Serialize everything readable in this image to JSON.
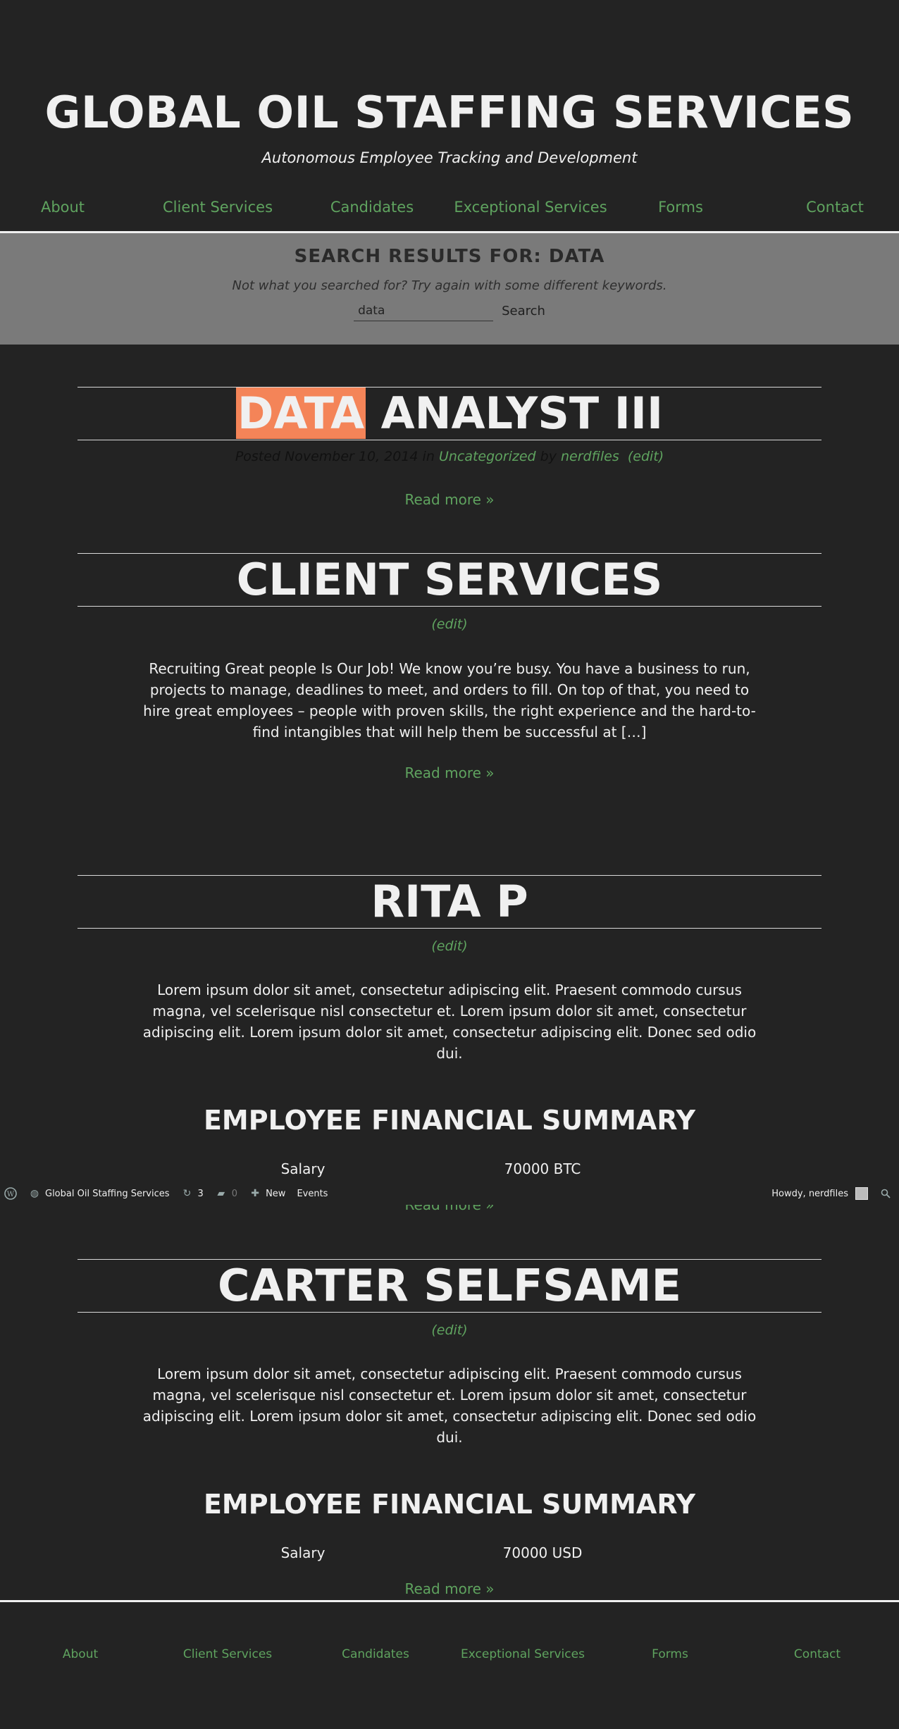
{
  "site": {
    "title": "GLOBAL OIL STAFFING SERVICES",
    "description": "Autonomous Employee Tracking and Development"
  },
  "nav": [
    "About",
    "Client Services",
    "Candidates",
    "Exceptional Services",
    "Forms",
    "Contact"
  ],
  "search": {
    "heading": "SEARCH RESULTS FOR: DATA",
    "hint": "Not what you searched for? Try again with some different keywords.",
    "value": "data",
    "button": "Search"
  },
  "posts": [
    {
      "title_highlight": "DATA",
      "title_rest": " ANALYST III",
      "meta_posted": "Posted November 10, 2014 in ",
      "meta_category": "Uncategorized",
      "meta_by": " by ",
      "meta_author": "nerdfiles",
      "edit": "(edit)",
      "read_more": "Read more »"
    },
    {
      "title": "CLIENT SERVICES",
      "edit": "(edit)",
      "excerpt": "Recruiting Great people Is Our Job! We know you’re busy. You have a business to run, projects to manage, deadlines to meet, and orders to fill. On top of that, you need to hire great employees – people with proven skills, the right experience and the hard-to-find intangibles that will help them be successful at […]",
      "read_more": "Read more »"
    },
    {
      "title": "RITA P",
      "edit": "(edit)",
      "excerpt": "Lorem ipsum dolor sit amet, consectetur adipiscing elit. Praesent commodo cursus magna, vel scelerisque nisl consectetur et. Lorem ipsum dolor sit amet, consectetur adipiscing elit. Lorem ipsum dolor sit amet, consectetur adipiscing elit. Donec sed odio dui.",
      "summary_heading": "EMPLOYEE FINANCIAL SUMMARY",
      "salary_label": "Salary",
      "salary_value": "70000 BTC",
      "read_more": "Read more »"
    },
    {
      "title": "CARTER SELFSAME",
      "edit": "(edit)",
      "excerpt": "Lorem ipsum dolor sit amet, consectetur adipiscing elit. Praesent commodo cursus magna, vel scelerisque nisl consectetur et. Lorem ipsum dolor sit amet, consectetur adipiscing elit. Lorem ipsum dolor sit amet, consectetur adipiscing elit. Donec sed odio dui.",
      "summary_heading": "EMPLOYEE FINANCIAL SUMMARY",
      "salary_label": "Salary",
      "salary_value": "70000 USD",
      "read_more": "Read more »"
    }
  ],
  "admin_bar": {
    "site_name": "Global Oil Staffing Services",
    "updates_count": "3",
    "comments_count": "0",
    "new_label": "New",
    "events_label": "Events",
    "howdy": "Howdy, nerdfiles"
  },
  "footer_nav": [
    "About",
    "Client Services",
    "Candidates",
    "Exceptional Services",
    "Forms",
    "Contact"
  ],
  "colors": {
    "background": "#232323",
    "link": "#5fa35f",
    "highlight": "#f48458",
    "search_band": "#7a7a7a"
  }
}
